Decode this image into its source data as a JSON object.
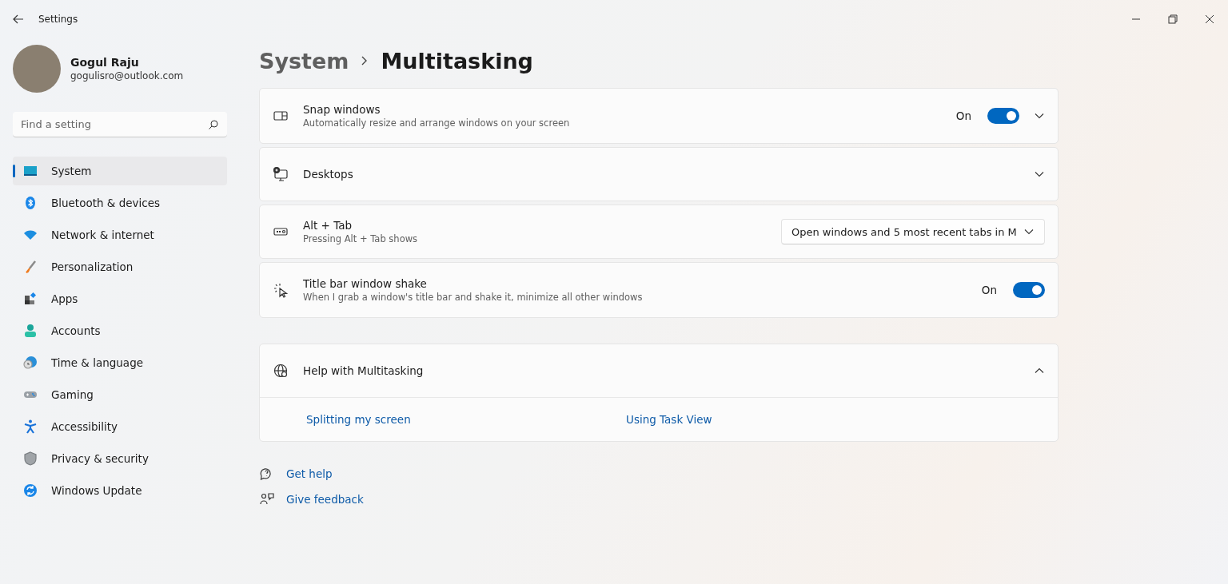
{
  "window": {
    "title": "Settings"
  },
  "user": {
    "name": "Gogul Raju",
    "email": "gogulisro@outlook.com"
  },
  "search": {
    "placeholder": "Find a setting"
  },
  "sidebar": {
    "items": [
      {
        "label": "System",
        "selected": true
      },
      {
        "label": "Bluetooth & devices",
        "selected": false
      },
      {
        "label": "Network & internet",
        "selected": false
      },
      {
        "label": "Personalization",
        "selected": false
      },
      {
        "label": "Apps",
        "selected": false
      },
      {
        "label": "Accounts",
        "selected": false
      },
      {
        "label": "Time & language",
        "selected": false
      },
      {
        "label": "Gaming",
        "selected": false
      },
      {
        "label": "Accessibility",
        "selected": false
      },
      {
        "label": "Privacy & security",
        "selected": false
      },
      {
        "label": "Windows Update",
        "selected": false
      }
    ]
  },
  "breadcrumb": {
    "parent": "System",
    "current": "Multitasking"
  },
  "settings": [
    {
      "kind": "toggle",
      "title": "Snap windows",
      "description": "Automatically resize and arrange windows on your screen",
      "state_label": "On",
      "on": true,
      "expandable": true,
      "expanded": false
    },
    {
      "kind": "plain",
      "title": "Desktops",
      "expandable": true,
      "expanded": false
    },
    {
      "kind": "dropdown",
      "title": "Alt + Tab",
      "description": "Pressing Alt + Tab shows",
      "value": "Open windows and 5 most recent tabs in M"
    },
    {
      "kind": "toggle",
      "title": "Title bar window shake",
      "description": "When I grab a window's title bar and shake it, minimize all other windows",
      "state_label": "On",
      "on": true
    }
  ],
  "help": {
    "title": "Help with Multitasking",
    "expanded": true,
    "links": [
      "Splitting my screen",
      "Using Task View"
    ]
  },
  "footer_links": [
    "Get help",
    "Give feedback"
  ]
}
